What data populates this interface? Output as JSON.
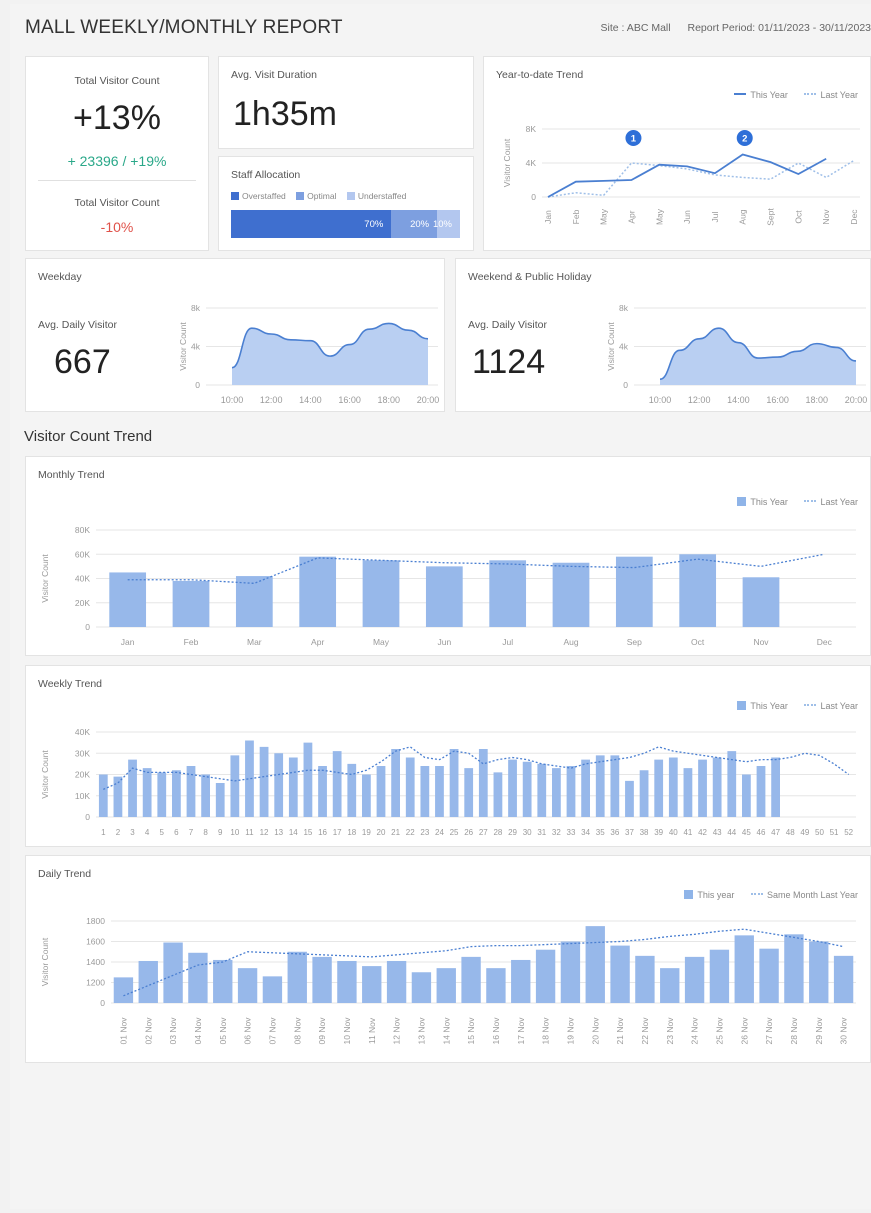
{
  "header": {
    "title": "MALL WEEKLY/MONTHLY REPORT",
    "site": "Site : ABC Mall",
    "period": "Report Period: 01/11/2023 - 30/11/2023"
  },
  "kpi_visitor": {
    "label": "Total Visitor Count",
    "value": "+13%",
    "sub": "+ 23396 / +19%",
    "label2": "Total Visitor Count",
    "value2": "-10%"
  },
  "kpi_duration": {
    "label": "Avg. Visit Duration",
    "value": "1h35m"
  },
  "staff": {
    "label": "Staff Allocation",
    "legend": [
      "Overstaffed",
      "Optimal",
      "Understaffed"
    ],
    "segments": [
      {
        "label": "70%",
        "value": 70,
        "color": "#3f6fcf"
      },
      {
        "label": "20%",
        "value": 20,
        "color": "#7d9fe0"
      },
      {
        "label": "10%",
        "value": 10,
        "color": "#b3c7ef"
      }
    ]
  },
  "ytd": {
    "title": "Year-to-date Trend",
    "legend_this": "This Year",
    "legend_last": "Last Year",
    "ylabel": "Visitor Count",
    "yticks": [
      "0",
      "4K",
      "8K"
    ],
    "markers": [
      "1",
      "2"
    ]
  },
  "weekday": {
    "title": "Weekday",
    "avg_label": "Avg. Daily Visitor",
    "avg_value": "667",
    "ylabel": "Visitor Count",
    "yticks": [
      "0",
      "4k",
      "8k"
    ]
  },
  "weekend": {
    "title": "Weekend & Public Holiday",
    "avg_label": "Avg. Daily Visitor",
    "avg_value": "1124",
    "ylabel": "Visitor Count",
    "yticks": [
      "0",
      "4k",
      "8k"
    ]
  },
  "section_title": "Visitor Count Trend",
  "monthly": {
    "title": "Monthly Trend",
    "legend_this": "This Year",
    "legend_last": "Last Year",
    "ylabel": "Visitor Count",
    "yticks": [
      "0",
      "20K",
      "40K",
      "60K",
      "80K"
    ]
  },
  "weekly": {
    "title": "Weekly Trend",
    "legend_this": "This Year",
    "legend_last": "Last Year",
    "ylabel": "Visitor Count",
    "yticks": [
      "0",
      "10K",
      "20K",
      "30K",
      "40K"
    ]
  },
  "daily": {
    "title": "Daily Trend",
    "legend_this": "This year",
    "legend_last": "Same Month Last Year",
    "ylabel": "Visitor Count",
    "yticks": [
      "0",
      "1200",
      "1400",
      "1600",
      "1800"
    ]
  },
  "colors": {
    "bar": "#97b8ea",
    "line": "#4a7fd1",
    "area": "#b9cff2"
  },
  "chart_data": [
    {
      "id": "ytd",
      "type": "line",
      "categories": [
        "Jan",
        "Feb",
        "May",
        "Apr",
        "May",
        "Jun",
        "Jul",
        "Aug",
        "Sept",
        "Oct",
        "Nov",
        "Dec"
      ],
      "series": [
        {
          "name": "This Year",
          "values": [
            0,
            1800,
            1900,
            2000,
            3800,
            3600,
            2800,
            5000,
            4100,
            2700,
            4500,
            null
          ]
        },
        {
          "name": "Last Year",
          "values": [
            0,
            500,
            200,
            4000,
            3700,
            3300,
            2600,
            2300,
            2100,
            4000,
            2300,
            4300
          ]
        }
      ],
      "ylim": [
        0,
        8000
      ]
    },
    {
      "id": "weekday",
      "type": "area",
      "x": [
        "10:00",
        "11:00",
        "12:00",
        "13:00",
        "14:00",
        "15:00",
        "16:00",
        "17:00",
        "18:00",
        "19:00",
        "20:00"
      ],
      "values": [
        1800,
        5900,
        5300,
        4700,
        4600,
        3000,
        4200,
        5800,
        6400,
        5700,
        4800
      ],
      "ylim": [
        0,
        8000
      ]
    },
    {
      "id": "weekend",
      "type": "area",
      "x": [
        "10:00",
        "11:00",
        "12:00",
        "13:00",
        "14:00",
        "15:00",
        "16:00",
        "17:00",
        "18:00",
        "19:00",
        "20:00"
      ],
      "values": [
        600,
        3600,
        4800,
        5900,
        4400,
        2800,
        2900,
        3500,
        4300,
        3900,
        2500
      ],
      "ylim": [
        0,
        8000
      ]
    },
    {
      "id": "monthly",
      "type": "bar",
      "categories": [
        "Jan",
        "Feb",
        "Mar",
        "Apr",
        "May",
        "Jun",
        "Jul",
        "Aug",
        "Sep",
        "Oct",
        "Nov",
        "Dec"
      ],
      "series": [
        {
          "name": "This Year",
          "values": [
            45000,
            38000,
            42000,
            58000,
            55000,
            50000,
            55000,
            53000,
            58000,
            60000,
            41000,
            null
          ]
        },
        {
          "name": "Last Year",
          "values": [
            39000,
            39000,
            36000,
            57000,
            55000,
            53000,
            52000,
            50000,
            49000,
            56000,
            50000,
            60000
          ]
        }
      ],
      "ylim": [
        0,
        80000
      ]
    },
    {
      "id": "weekly",
      "type": "bar",
      "categories": [
        "1",
        "2",
        "3",
        "4",
        "5",
        "6",
        "7",
        "8",
        "9",
        "10",
        "11",
        "12",
        "13",
        "14",
        "15",
        "16",
        "17",
        "18",
        "19",
        "20",
        "21",
        "22",
        "23",
        "24",
        "25",
        "26",
        "27",
        "28",
        "29",
        "30",
        "31",
        "32",
        "33",
        "34",
        "35",
        "36",
        "37",
        "38",
        "39",
        "40",
        "41",
        "42",
        "43",
        "44",
        "45",
        "46",
        "47",
        "48",
        "49",
        "50",
        "51",
        "52"
      ],
      "series": [
        {
          "name": "This Year",
          "values": [
            20000,
            19000,
            27000,
            23000,
            21000,
            22000,
            24000,
            20000,
            16000,
            29000,
            36000,
            33000,
            30000,
            28000,
            35000,
            24000,
            31000,
            25000,
            20000,
            24000,
            32000,
            28000,
            24000,
            24000,
            32000,
            23000,
            32000,
            21000,
            27000,
            26000,
            25000,
            23000,
            24000,
            27000,
            29000,
            29000,
            17000,
            22000,
            27000,
            28000,
            23000,
            27000,
            28000,
            31000,
            20000,
            24000,
            28000,
            null,
            null,
            null,
            null,
            null
          ]
        },
        {
          "name": "Last Year",
          "values": [
            13000,
            16000,
            23000,
            21000,
            21000,
            21000,
            20000,
            19000,
            18000,
            17000,
            18000,
            19000,
            20000,
            21000,
            22000,
            22000,
            21000,
            20000,
            22000,
            26000,
            31000,
            33000,
            28000,
            27000,
            31000,
            30000,
            25000,
            27000,
            28000,
            27000,
            25000,
            24000,
            23000,
            25000,
            26000,
            27000,
            28000,
            30000,
            33000,
            31000,
            30000,
            29000,
            28000,
            27000,
            26000,
            27000,
            27000,
            28000,
            30000,
            29000,
            25000,
            20000
          ]
        }
      ],
      "ylim": [
        0,
        40000
      ]
    },
    {
      "id": "daily",
      "type": "bar",
      "categories": [
        "01 Nov",
        "02 Nov",
        "03 Nov",
        "04 Nov",
        "05 Nov",
        "06 Nov",
        "07 Nov",
        "08 Nov",
        "09 Nov",
        "10 Nov",
        "11 Nov",
        "12 Nov",
        "13 Nov",
        "14 Nov",
        "15 Nov",
        "16 Nov",
        "17 Nov",
        "18 Nov",
        "19 Nov",
        "20 Nov",
        "21 Nov",
        "22 Nov",
        "23 Nov",
        "24 Nov",
        "25 Nov",
        "26 Nov",
        "27 Nov",
        "28 Nov",
        "29 Nov",
        "30 Nov"
      ],
      "series": [
        {
          "name": "This year",
          "values": [
            1250,
            1410,
            1590,
            1490,
            1420,
            1340,
            1260,
            1500,
            1450,
            1410,
            1360,
            1410,
            1300,
            1340,
            1450,
            1340,
            1420,
            1520,
            1600,
            1750,
            1560,
            1460,
            1340,
            1450,
            1520,
            1660,
            1530,
            1670,
            1600,
            1460
          ]
        },
        {
          "name": "Same Month Last Year",
          "values": [
            1070,
            1170,
            1270,
            1370,
            1400,
            1500,
            1490,
            1480,
            1470,
            1460,
            1450,
            1470,
            1490,
            1510,
            1550,
            1560,
            1560,
            1570,
            1580,
            1590,
            1600,
            1620,
            1650,
            1670,
            1700,
            1720,
            1680,
            1640,
            1600,
            1550
          ]
        }
      ],
      "ylim": [
        1000,
        1800
      ]
    }
  ]
}
